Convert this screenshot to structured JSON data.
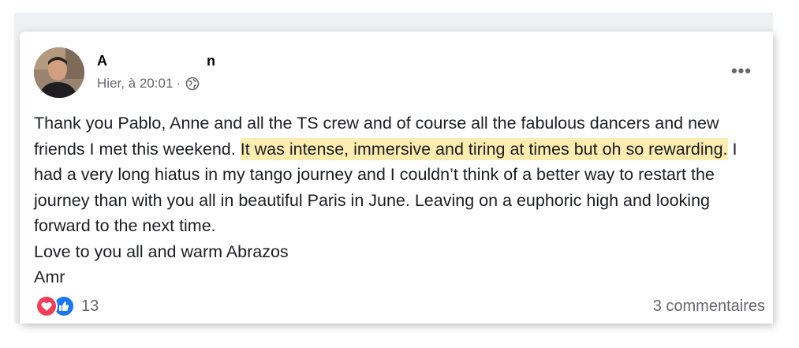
{
  "post": {
    "author": {
      "name_start": "A",
      "name_end": "n"
    },
    "timestamp": "Hier, à 20:01",
    "separator": "·",
    "privacy_icon": "globe-icon",
    "more_label": "•••",
    "body": {
      "p1_before": "Thank you Pablo, Anne and all the TS crew and of course all the fabulous dancers and new friends I met this weekend. ",
      "p1_highlight": "It was intense, immersive and tiring at times but oh so rewarding.",
      "p1_after": " I had a very long hiatus in my tango journey and I couldn’t think of a better way to restart the journey than with you all in beautiful Paris in June. Leaving on a euphoric high and looking forward to the next time.",
      "p2": "Love to you all and warm Abrazos",
      "p3": "Amr"
    },
    "reactions": {
      "icons": [
        "love-reaction-icon",
        "like-reaction-icon"
      ],
      "count": "13"
    },
    "comments_label": "3 commentaires"
  },
  "colors": {
    "highlight": "#fcecb0",
    "text": "#1c1e21",
    "muted": "#65676b",
    "love": "#f33e58",
    "like": "#1877f2"
  }
}
